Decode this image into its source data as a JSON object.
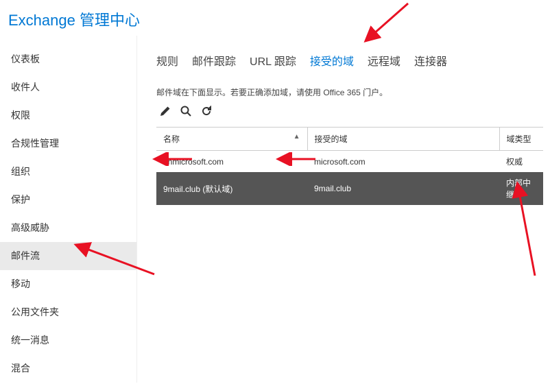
{
  "header": {
    "title": "Exchange 管理中心"
  },
  "sidebar": {
    "items": [
      {
        "label": "仪表板",
        "selected": false
      },
      {
        "label": "收件人",
        "selected": false
      },
      {
        "label": "权限",
        "selected": false
      },
      {
        "label": "合规性管理",
        "selected": false
      },
      {
        "label": "组织",
        "selected": false
      },
      {
        "label": "保护",
        "selected": false
      },
      {
        "label": "高级威胁",
        "selected": false
      },
      {
        "label": "邮件流",
        "selected": true
      },
      {
        "label": "移动",
        "selected": false
      },
      {
        "label": "公用文件夹",
        "selected": false
      },
      {
        "label": "统一消息",
        "selected": false
      },
      {
        "label": "混合",
        "selected": false
      }
    ]
  },
  "tabs": [
    {
      "label": "规则",
      "active": false
    },
    {
      "label": "邮件跟踪",
      "active": false
    },
    {
      "label": "URL 跟踪",
      "active": false
    },
    {
      "label": "接受的域",
      "active": true
    },
    {
      "label": "远程域",
      "active": false
    },
    {
      "label": "连接器",
      "active": false
    }
  ],
  "description": "邮件域在下面显示。若要正确添加域，请使用 Office 365 门户。",
  "toolbar": {
    "edit_title": "编辑",
    "search_title": "搜索",
    "refresh_title": "刷新"
  },
  "table": {
    "columns": {
      "name": "名称",
      "accepted_domain": "接受的域",
      "domain_type": "域类型"
    },
    "rows": [
      {
        "name": "onmicrosoft.com",
        "domain": "microsoft.com",
        "type": "权威",
        "selected": false
      },
      {
        "name": "9mail.club (默认域)",
        "domain": "9mail.club",
        "type": "内部中继",
        "selected": true
      }
    ]
  }
}
